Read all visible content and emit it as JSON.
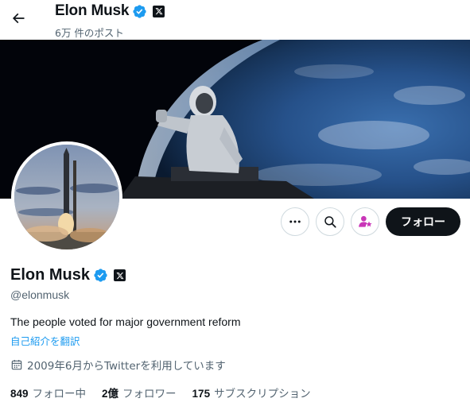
{
  "header": {
    "name": "Elon Musk",
    "post_count": "6万 件のポスト"
  },
  "profile": {
    "name": "Elon Musk",
    "handle": "@elonmusk",
    "bio": "The people voted for major government reform",
    "translate_link": "自己紹介を翻訳",
    "joined": "2009年6月からTwitterを利用しています"
  },
  "actions": {
    "follow_label": "フォロー"
  },
  "stats": [
    {
      "value": "849",
      "label": "フォロー中"
    },
    {
      "value": "2億",
      "label": "フォロワー"
    },
    {
      "value": "175",
      "label": "サブスクリプション"
    }
  ],
  "colors": {
    "verified_blue": "#1d9bf0",
    "subscribe_pink": "#c936b8",
    "text_primary": "#0f1419",
    "text_secondary": "#536471"
  },
  "icons": {
    "back": "arrow-left-icon",
    "verified": "verified-badge-icon",
    "affiliation": "x-logo-icon",
    "more": "more-dots-icon",
    "search": "search-icon",
    "subscribe": "subscribe-person-star-icon",
    "calendar": "calendar-icon"
  }
}
